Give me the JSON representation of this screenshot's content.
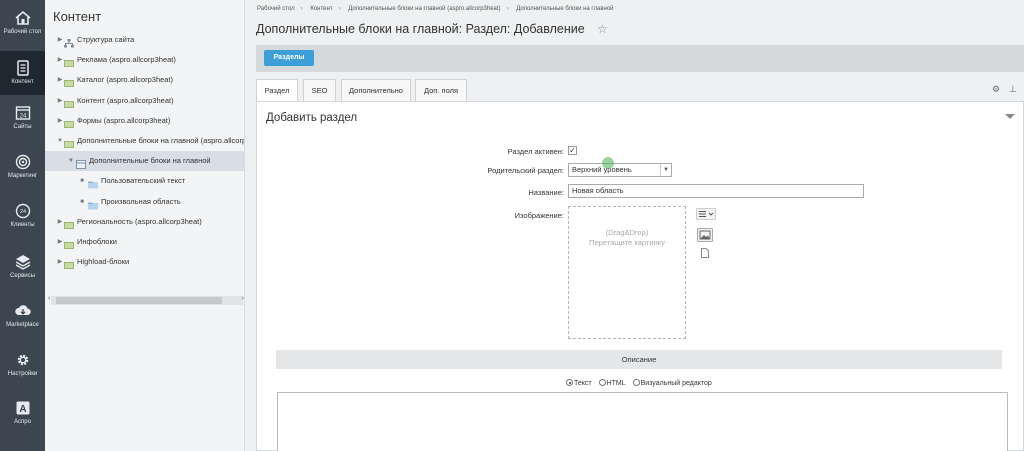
{
  "rail": {
    "items": [
      {
        "label": "Рабочий стол",
        "icon": "home-icon"
      },
      {
        "label": "Контент",
        "icon": "document-icon",
        "active": true
      },
      {
        "label": "Сайты",
        "icon": "calendar-icon",
        "badge": "24"
      },
      {
        "label": "Маркетинг",
        "icon": "target-icon"
      },
      {
        "label": "Клиенты",
        "icon": "clock-24-icon",
        "badge": "24"
      },
      {
        "label": "Сервисы",
        "icon": "layers-icon"
      },
      {
        "label": "Marketplace",
        "icon": "cloud-download-icon"
      },
      {
        "label": "Настройки",
        "icon": "gear-icon"
      },
      {
        "label": "Аспро",
        "icon": "letter-a-icon",
        "glyph": "A"
      }
    ]
  },
  "tree": {
    "title": "Контент",
    "items": [
      {
        "label": "Структура сайта",
        "icon": "sitemap-icon",
        "arrow": "▶"
      },
      {
        "label": "Реклама (aspro.allcorp3heat)",
        "icon": "iblock-icon",
        "arrow": "▶"
      },
      {
        "label": "Каталог (aspro.allcorp3heat)",
        "icon": "iblock-icon",
        "arrow": "▶"
      },
      {
        "label": "Контент (aspro.allcorp3heat)",
        "icon": "iblock-icon",
        "arrow": "▶"
      },
      {
        "label": "Формы (aspro.allcorp3heat)",
        "icon": "iblock-icon",
        "arrow": "▶"
      },
      {
        "label": "Дополнительные блоки на главной (aspro.allcorp3",
        "icon": "iblock-icon",
        "arrow": "▼"
      },
      {
        "label": "Дополнительные блоки на главной",
        "icon": "block-icon",
        "arrow": "▼",
        "selected": true
      },
      {
        "label": "Пользовательский текст",
        "icon": "folder-icon",
        "arrow": "■"
      },
      {
        "label": "Произвольная область",
        "icon": "folder-icon",
        "arrow": "■"
      },
      {
        "label": "Региональность (aspro.allcorp3heat)",
        "icon": "iblock-icon",
        "arrow": "▶"
      },
      {
        "label": "Инфоблоки",
        "icon": "iblock-icon",
        "arrow": "▶"
      },
      {
        "label": "Highload-блоки",
        "icon": "iblock-icon",
        "arrow": "▶"
      }
    ]
  },
  "breadcrumbs": [
    "Рабочий стол",
    "Контент",
    "Дополнительные блоки на главной (aspro.allcorp3heat)",
    "Дополнительные блоки на главной"
  ],
  "page_title": "Дополнительные блоки на главной: Раздел: Добавление",
  "toolbar": {
    "sections_label": "Разделы"
  },
  "tabs": [
    {
      "label": "Раздел",
      "active": true
    },
    {
      "label": "SEO"
    },
    {
      "label": "Дополнительно"
    },
    {
      "label": "Доп. поля"
    }
  ],
  "form": {
    "title": "Добавить раздел",
    "active_label": "Раздел активен:",
    "active_checked": true,
    "check_mark": "✓",
    "parent_label": "Родительский раздел:",
    "parent_value": "Верхний уровень",
    "name_label": "Название:",
    "name_value": "Новая область",
    "image_label": "Изображение:",
    "dropzone_line1": "(Drag&Drop)",
    "dropzone_line2": "Перетащите картинку",
    "description_label": "Описание",
    "editor_modes": [
      {
        "label": "Текст",
        "selected": true
      },
      {
        "label": "HTML"
      },
      {
        "label": "Визуальный редактор"
      }
    ]
  },
  "colors": {
    "rail_bg": "#3c4650",
    "accent": "#3d9fd8",
    "cursor": "#4caf50"
  }
}
